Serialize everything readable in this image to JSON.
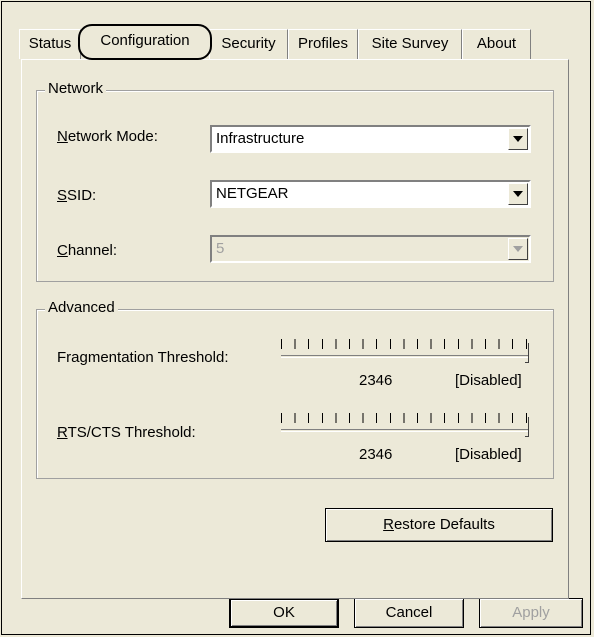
{
  "tabs": [
    {
      "label": "Status"
    },
    {
      "label": "Configuration"
    },
    {
      "label": "Security"
    },
    {
      "label": "Profiles"
    },
    {
      "label": "Site Survey"
    },
    {
      "label": "About"
    }
  ],
  "network": {
    "group_label": "Network",
    "mode_label_first": "N",
    "mode_label_rest": "etwork Mode:",
    "mode_value": "Infrastructure",
    "ssid_label_first": "S",
    "ssid_label_rest": "SID:",
    "ssid_value": "NETGEAR",
    "channel_label_first": "C",
    "channel_label_rest": "hannel:",
    "channel_value": "5"
  },
  "advanced": {
    "group_label": "Advanced",
    "frag_label": "Fragmentation Threshold:",
    "frag_value": "2346",
    "frag_state": "[Disabled]",
    "frag_level": 1.0,
    "rts_label_first": "R",
    "rts_label_rest": "TS/CTS Threshold:",
    "rts_value": "2346",
    "rts_state": "[Disabled]",
    "rts_level": 1.0
  },
  "buttons": {
    "restore_first": "R",
    "restore_rest": "estore Defaults",
    "ok": "OK",
    "cancel": "Cancel",
    "apply": "Apply"
  }
}
